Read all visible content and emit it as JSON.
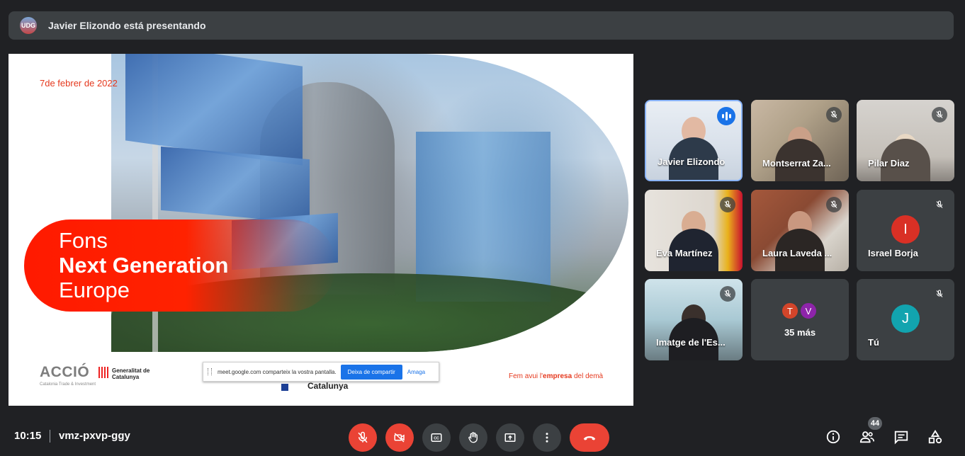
{
  "banner": {
    "presenter_text": "Javier Elizondo está presentando",
    "avatar_initials": "UDG"
  },
  "slide": {
    "date": "7de febrer de 2022",
    "title_line1": "Fons",
    "title_line2": "Next Generation",
    "title_line3": "Europe",
    "logo_accio": "ACCIÓ",
    "logo_accio_sub": "Catalonia Trade & Investment",
    "logo_gen": "Generalitat de Catalunya",
    "logo_catalunya": "Catalunya",
    "tagline_pre": "Fem avui l'",
    "tagline_bold": "empresa",
    "tagline_post": " del demà"
  },
  "share_bar": {
    "message": "meet.google.com comparteix la vostra pantalla.",
    "stop_label": "Deixa de compartir",
    "hide_label": "Amaga"
  },
  "participants": [
    {
      "name": "Javier Elizondo"
    },
    {
      "name": "Montserrat Za..."
    },
    {
      "name": "Pilar Diaz"
    },
    {
      "name": "Eva Martínez"
    },
    {
      "name": "Laura Laveda ..."
    },
    {
      "name": "Israel Borja",
      "initial": "I"
    },
    {
      "name": "Imatge de l'Es..."
    },
    {
      "name": "Tú",
      "initial": "J"
    }
  ],
  "more": {
    "initial_1": "T",
    "initial_2": "V",
    "label": "35 más"
  },
  "bottom": {
    "time": "10:15",
    "meeting_code": "vmz-pxvp-ggy",
    "people_count": "44"
  },
  "colors": {
    "accent_red": "#ea4335",
    "accent_blue": "#1a73e8",
    "tile_bg": "#3c4043",
    "avatar_israel": "#d93025",
    "avatar_you": "#12a4af",
    "avatar_t": "#d2452a",
    "avatar_v": "#8e24aa"
  }
}
